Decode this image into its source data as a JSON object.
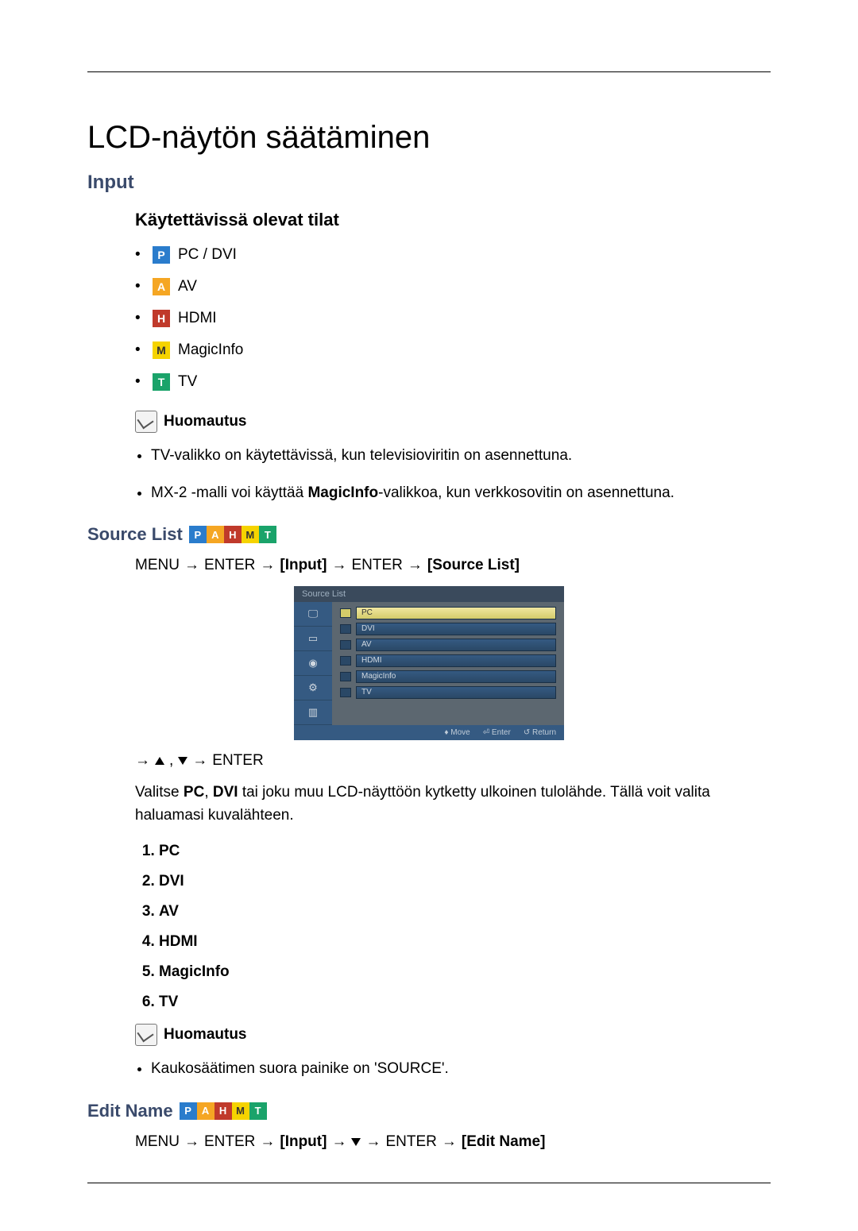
{
  "title": "LCD-näytön säätäminen",
  "input_heading": "Input",
  "modes_heading": "Käytettävissä olevat tilat",
  "modes": {
    "p": "PC / DVI",
    "a": "AV",
    "h": "HDMI",
    "m": "MagicInfo",
    "t": "TV"
  },
  "note_label": "Huomautus",
  "notes1": {
    "a": "TV-valikko on käytettävissä, kun televisioviritin on asennettuna.",
    "b_prefix": "MX-2 -malli voi käyttää ",
    "b_bold": "MagicInfo",
    "b_suffix": "-valikkoa, kun verkkosovitin on asennettuna."
  },
  "source_list_heading": "Source List",
  "nav1": {
    "menu": "MENU",
    "enter": "ENTER",
    "input": "Input",
    "source_list": "Source List"
  },
  "osd": {
    "title": "Source List",
    "items": [
      "PC",
      "DVI",
      "AV",
      "HDMI",
      "MagicInfo",
      "TV"
    ],
    "footer": {
      "move": "Move",
      "enter": "Enter",
      "return": "Return"
    }
  },
  "nav2_enter": "ENTER",
  "source_desc_prefix": "Valitse ",
  "source_desc_pc": "PC",
  "source_desc_mid": ", ",
  "source_desc_dvi": "DVI",
  "source_desc_suffix": " tai joku muu LCD-näyttöön kytketty ulkoinen tulolähde. Tällä voit valita haluamasi kuvalähteen.",
  "enum": [
    "PC",
    "DVI",
    "AV",
    "HDMI",
    "MagicInfo",
    "TV"
  ],
  "note2_text": "Kaukosäätimen suora painike on 'SOURCE'.",
  "edit_name_heading": "Edit Name",
  "nav3": {
    "menu": "MENU",
    "enter": "ENTER",
    "input": "Input",
    "enter2": "ENTER",
    "edit_name": "Edit Name"
  }
}
